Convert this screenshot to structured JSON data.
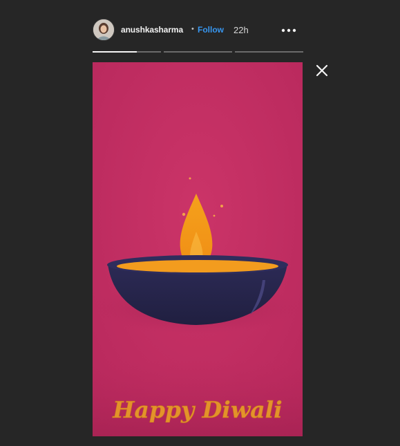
{
  "header": {
    "username": "anushkasharma",
    "separator": "•",
    "follow_label": "Follow",
    "timestamp": "22h"
  },
  "icons": {
    "avatar": "profile-avatar",
    "more": "more-options-icon",
    "close": "close-icon"
  },
  "progress": {
    "segments": 3,
    "current_segment": 1,
    "current_progress_fraction": 0.65
  },
  "story": {
    "overlay_text": "Happy Diwali",
    "colors": {
      "background": "#c32d63",
      "bowl": "#2a2850",
      "oil": "#f39c1e",
      "flame": "#f7a21b",
      "text": "#e3932a"
    }
  }
}
